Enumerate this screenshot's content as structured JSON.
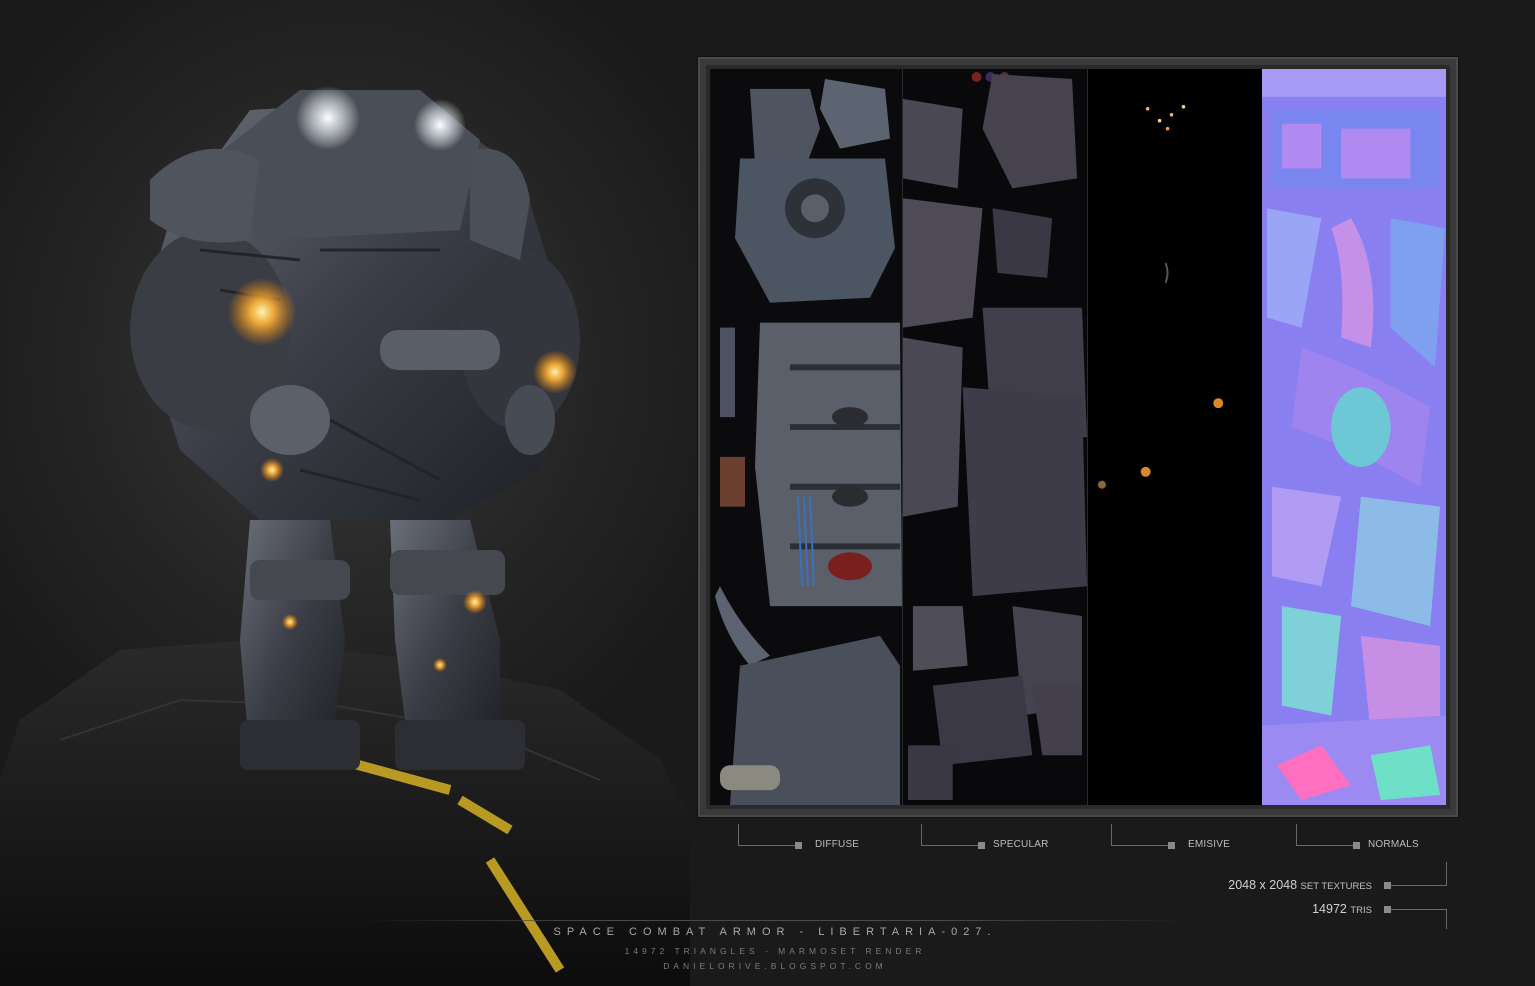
{
  "texture_labels": {
    "diffuse": "DIFFUSE",
    "specular": "SPECULAR",
    "emissive": "EMISIVE",
    "normals": "NORMALS"
  },
  "stats": {
    "texture_size": "2048 x 2048",
    "texture_size_suffix": "SET TEXTURES",
    "tris_count": "14972",
    "tris_suffix": "TRIS"
  },
  "caption": {
    "title": "SPACE COMBAT ARMOR - LIBERTARIA-027.",
    "subtitle": "14972 TRIANGLES - MARMOSET RENDER",
    "url": "DANIELORIVE.BLOGSPOT.COM"
  },
  "colors": {
    "background": "#1c1c1c",
    "normals": "#8a7ff0",
    "light_glow": "#ffb43a",
    "road_stripe": "#b89a22"
  }
}
